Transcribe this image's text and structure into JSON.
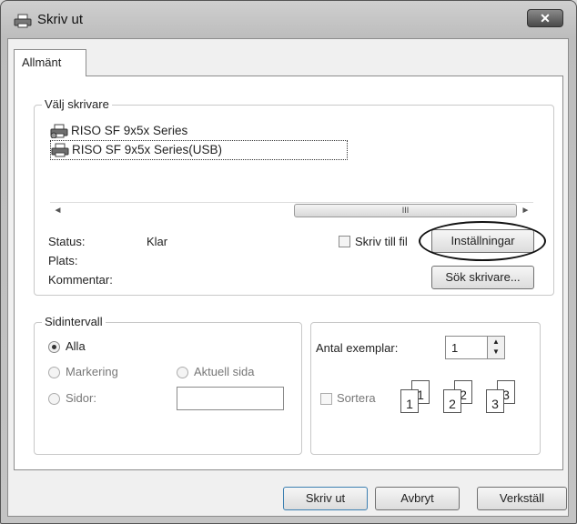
{
  "window": {
    "title": "Skriv ut",
    "close_label": "✕"
  },
  "tabs": [
    {
      "label": "Allmänt"
    }
  ],
  "printer_group": {
    "legend": "Välj skrivare",
    "printers": [
      {
        "label": "RISO SF 9x5x Series"
      },
      {
        "label": "RISO SF 9x5x Series(USB)"
      }
    ],
    "scroll_left": "◄",
    "scroll_right": "►",
    "scroll_grip": "III",
    "status_label": "Status:",
    "status_value": "Klar",
    "location_label": "Plats:",
    "comment_label": "Kommentar:",
    "print_to_file_label": "Skriv till fil",
    "settings_button": "Inställningar",
    "find_printer_button": "Sök skrivare..."
  },
  "page_range": {
    "legend": "Sidintervall",
    "all_label": "Alla",
    "selection_label": "Markering",
    "current_page_label": "Aktuell sida",
    "pages_label": "Sidor:",
    "pages_value": ""
  },
  "copies": {
    "count_label": "Antal exemplar:",
    "count_value": "1",
    "collate_label": "Sortera",
    "spin_up": "▲",
    "spin_down": "▼",
    "collate_pages": [
      "1",
      "1",
      "2",
      "2",
      "3",
      "3"
    ]
  },
  "footer": {
    "print_button": "Skriv ut",
    "cancel_button": "Avbryt",
    "apply_button": "Verkställ"
  }
}
